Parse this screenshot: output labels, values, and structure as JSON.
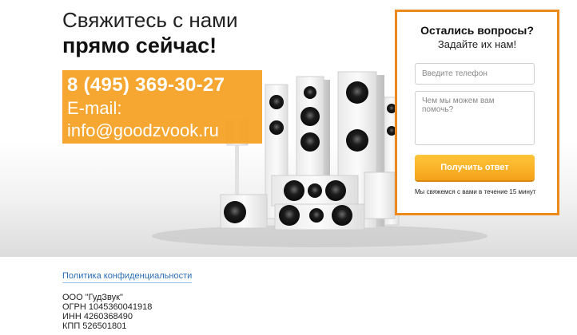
{
  "headline": {
    "line1": "Свяжитесь с нами",
    "line2": "прямо сейчас!"
  },
  "contact": {
    "phone": "8 (495) 369-30-27",
    "email_label": "E-mail:",
    "email": "info@goodzvook.ru"
  },
  "form": {
    "title": "Остались вопросы?",
    "subtitle": "Задайте их нам!",
    "phone_placeholder": "Введите телефон",
    "question_placeholder": "Чем мы можем вам помочь?",
    "submit_label": "Получить ответ",
    "note": "Мы свяжемся с вами в течение 15 минут"
  },
  "footer": {
    "policy_link": "Политика конфиденциальности",
    "company": "ООО \"ГудЗвук\"",
    "ogrn": "ОГРН 1045360041918",
    "inn": "ИНН 4260368490",
    "kpp": "КПП 526501801"
  },
  "colors": {
    "accent": "#f5a020",
    "form_border": "#ee8a1c",
    "link": "#2a6db5"
  }
}
